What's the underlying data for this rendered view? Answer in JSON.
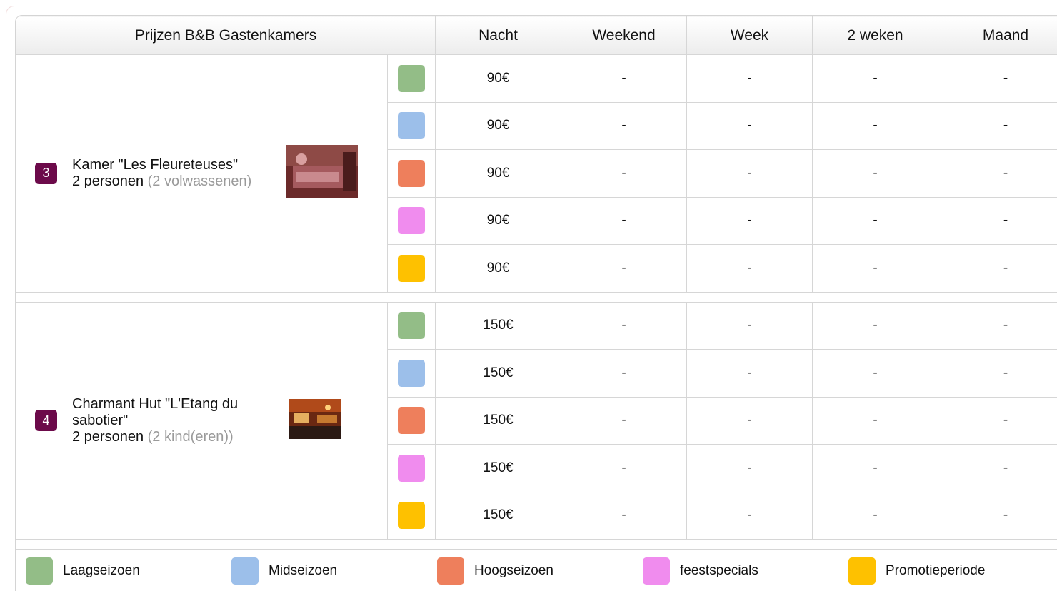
{
  "table": {
    "headers": [
      "Prijzen B&B Gastenkamers",
      "Nacht",
      "Weekend",
      "Week",
      "2 weken",
      "Maand"
    ]
  },
  "seasons": [
    {
      "label": "Laagseizoen",
      "color": "#93bd87"
    },
    {
      "label": "Midseizoen",
      "color": "#9cbfea"
    },
    {
      "label": "Hoogseizoen",
      "color": "#ee7f5c"
    },
    {
      "label": "feestspecials",
      "color": "#f08cee"
    },
    {
      "label": "Promotieperiode",
      "color": "#fec100"
    }
  ],
  "rooms": [
    {
      "number": "3",
      "name": "Kamer \"Les Fleureteuses\"",
      "persons": "2 personen",
      "detail": "(2 volwassenen)",
      "photo_icon": "room-photo-icon",
      "prices": [
        [
          "90€",
          "-",
          "-",
          "-",
          "-"
        ],
        [
          "90€",
          "-",
          "-",
          "-",
          "-"
        ],
        [
          "90€",
          "-",
          "-",
          "-",
          "-"
        ],
        [
          "90€",
          "-",
          "-",
          "-",
          "-"
        ],
        [
          "90€",
          "-",
          "-",
          "-",
          "-"
        ]
      ]
    },
    {
      "number": "4",
      "name": "Charmant Hut \"L'Etang du sabotier\"",
      "persons": "2 personen",
      "detail": "(2 kind(eren))",
      "photo_icon": "hut-photo-icon",
      "prices": [
        [
          "150€",
          "-",
          "-",
          "-",
          "-"
        ],
        [
          "150€",
          "-",
          "-",
          "-",
          "-"
        ],
        [
          "150€",
          "-",
          "-",
          "-",
          "-"
        ],
        [
          "150€",
          "-",
          "-",
          "-",
          "-"
        ],
        [
          "150€",
          "-",
          "-",
          "-",
          "-"
        ]
      ]
    }
  ]
}
